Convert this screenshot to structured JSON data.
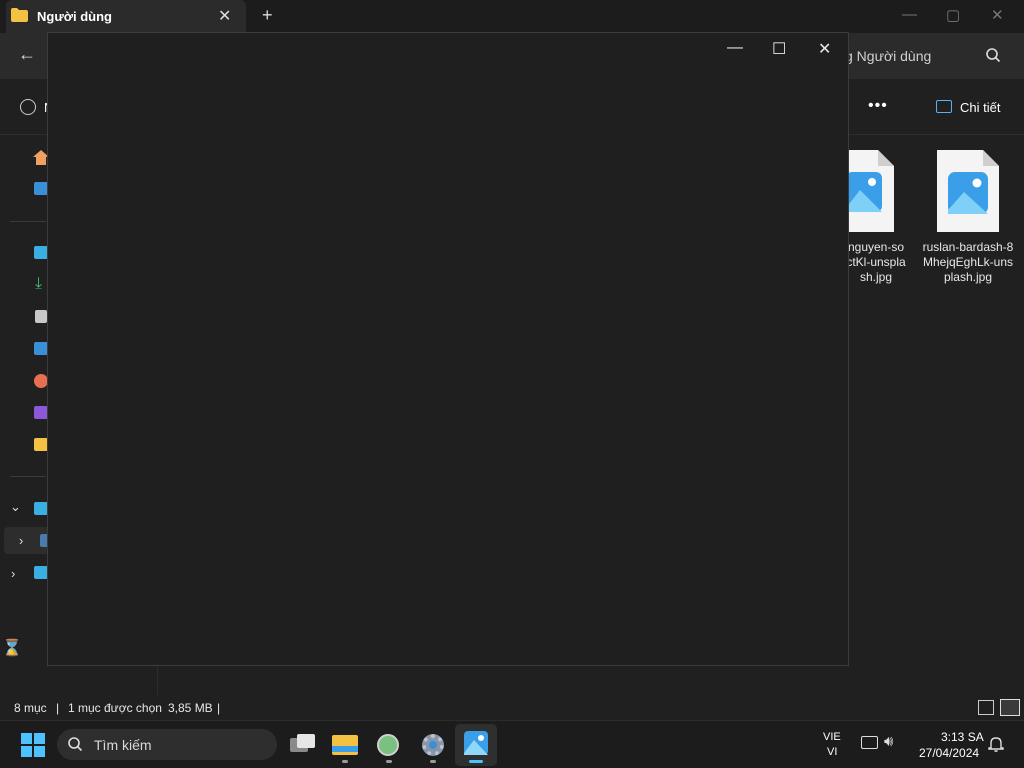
{
  "tab": {
    "title": "Người dùng",
    "close": "✕",
    "new": "+"
  },
  "window_controls": {
    "minimize": "—",
    "maximize": "▢",
    "close": "✕"
  },
  "nav": {
    "back": "←"
  },
  "search": {
    "text": "g Người dùng"
  },
  "toolbar": {
    "new_label": "N",
    "more": "•••",
    "details_label": "Chi tiết"
  },
  "sidebar": {
    "expand_chevrons": [
      "⌄",
      "›",
      "›"
    ]
  },
  "files": [
    {
      "name": "nguyen-so ctKl-unspla sh.jpg",
      "lines": [
        "nguyen-so",
        "ctKl-unspla",
        "sh.jpg"
      ]
    },
    {
      "name": "ruslan-bardash-8MhejqEghLk-unsplash.jpg",
      "lines": [
        "ruslan-bardash-8",
        "MhejqEghLk-uns",
        "plash.jpg"
      ]
    }
  ],
  "dialog": {
    "minimize": "—",
    "maximize": "☐",
    "close": "✕"
  },
  "status": {
    "count": "8 mục",
    "selected": "1 mục được chọn",
    "size": "3,85 MB",
    "sep": "|"
  },
  "taskbar": {
    "search_label": "Tìm kiếm",
    "lang_top": "VIE",
    "lang_bottom": "VI",
    "time": "3:13 SA",
    "date": "27/04/2024"
  },
  "colors": {
    "accent": "#5ab0f0",
    "folder": "#f4c242",
    "background": "#202020"
  }
}
